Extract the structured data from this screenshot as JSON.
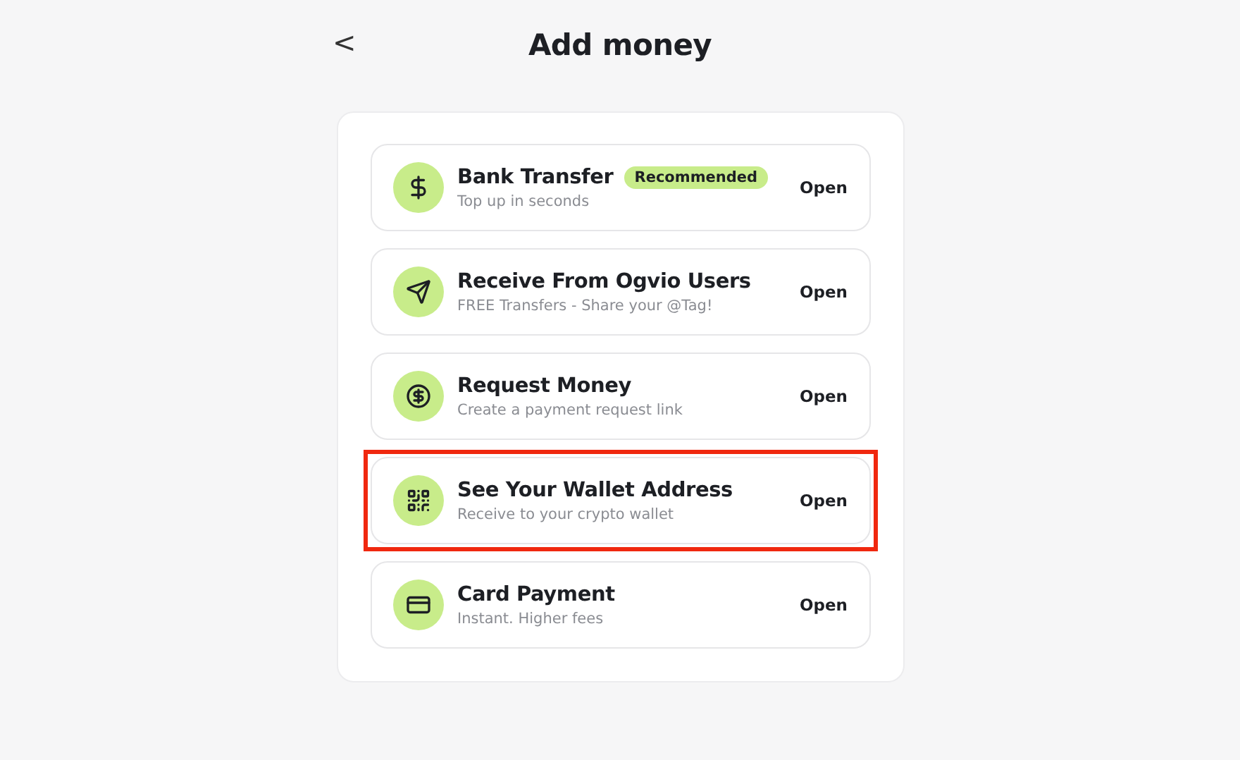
{
  "header": {
    "back": "<",
    "title": "Add money"
  },
  "items": [
    {
      "title": "Bank Transfer",
      "badge": "Recommended",
      "subtitle": "Top up in seconds",
      "action": "Open",
      "highlighted": false
    },
    {
      "title": "Receive From Ogvio Users",
      "subtitle": "FREE Transfers - Share your @Tag!",
      "action": "Open",
      "highlighted": false
    },
    {
      "title": "Request Money",
      "subtitle": "Create a payment request link",
      "action": "Open",
      "highlighted": false
    },
    {
      "title": "See Your Wallet Address",
      "subtitle": "Receive to your crypto wallet",
      "action": "Open",
      "highlighted": true
    },
    {
      "title": "Card Payment",
      "subtitle": "Instant. Higher fees",
      "action": "Open",
      "highlighted": false
    }
  ]
}
